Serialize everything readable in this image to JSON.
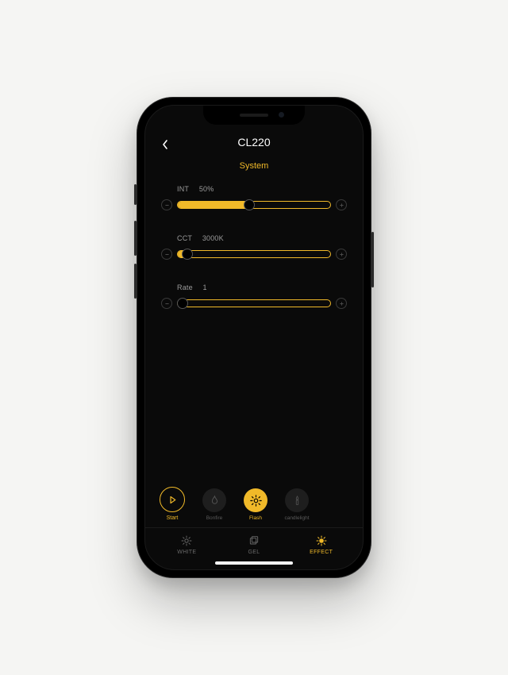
{
  "header": {
    "title": "CL220",
    "subtitle": "System"
  },
  "sliders": {
    "int": {
      "label": "INT",
      "value": "50%",
      "fillPct": 47
    },
    "cct": {
      "label": "CCT",
      "value": "3000K",
      "fillPct": 6
    },
    "rate": {
      "label": "Rate",
      "value": "1",
      "fillPct": 3
    }
  },
  "start": {
    "label": "Start"
  },
  "effects": [
    {
      "label": "Bonfire",
      "active": false,
      "icon": "fire-icon"
    },
    {
      "label": "Flash",
      "active": true,
      "icon": "flash-icon"
    },
    {
      "label": "candlelight",
      "active": false,
      "icon": "candle-icon"
    }
  ],
  "tabs": [
    {
      "label": "WHITE",
      "active": false,
      "icon": "sun-outline-icon"
    },
    {
      "label": "GEL",
      "active": false,
      "icon": "gel-icon"
    },
    {
      "label": "EFFECT",
      "active": true,
      "icon": "sun-fill-icon"
    }
  ],
  "colors": {
    "accent": "#f0b929"
  }
}
